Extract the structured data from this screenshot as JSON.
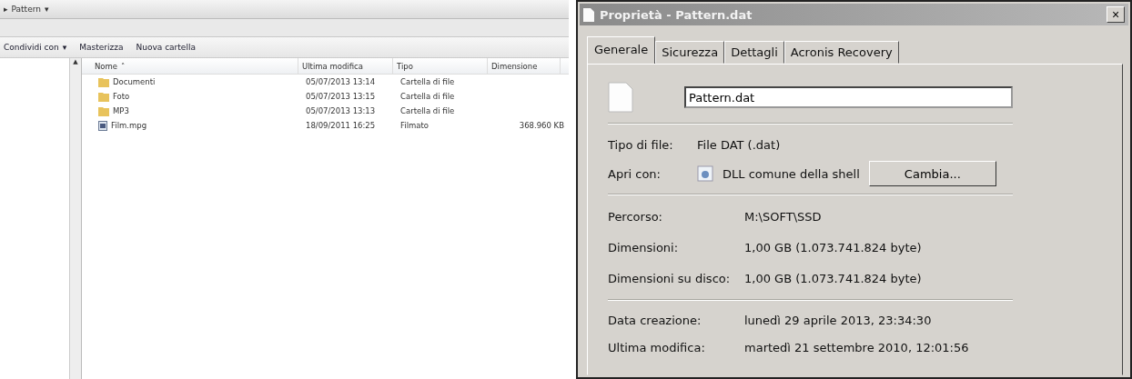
{
  "explorer": {
    "breadcrumb": {
      "arrow": "▸",
      "location": "Pattern",
      "caret": "▾"
    },
    "toolbar": [
      {
        "label": "Condividi con",
        "caret": "▾"
      },
      {
        "label": "Masterizza"
      },
      {
        "label": "Nuova cartella"
      }
    ],
    "nav_scroll_arrow": "▲",
    "columns": [
      "Nome",
      "Ultima modifica",
      "Tipo",
      "Dimensione"
    ],
    "sort_mark": "˄",
    "rows": [
      {
        "kind": "folder",
        "name": "Documenti",
        "modified": "05/07/2013 13:14",
        "type": "Cartella di file",
        "size": ""
      },
      {
        "kind": "folder",
        "name": "Foto",
        "modified": "05/07/2013 13:15",
        "type": "Cartella di file",
        "size": ""
      },
      {
        "kind": "folder",
        "name": "MP3",
        "modified": "05/07/2013 13:13",
        "type": "Cartella di file",
        "size": ""
      },
      {
        "kind": "video",
        "name": "Film.mpg",
        "modified": "18/09/2011 16:25",
        "type": "Filmato",
        "size": "368.960 KB"
      }
    ]
  },
  "dialog": {
    "title": "Proprietà - Pattern.dat",
    "close": "×",
    "tabs": [
      {
        "label": "Generale",
        "selected": true
      },
      {
        "label": "Sicurezza",
        "selected": false
      },
      {
        "label": "Dettagli",
        "selected": false
      },
      {
        "label": "Acronis Recovery",
        "selected": false
      }
    ],
    "file_name": "Pattern.dat",
    "file_type": {
      "label": "Tipo di file:",
      "value": "File DAT (.dat)"
    },
    "open_with": {
      "label": "Apri con:",
      "value": "DLL comune della shell",
      "button": "Cambia..."
    },
    "groups": [
      [
        {
          "label": "Percorso:",
          "value": "M:\\SOFT\\SSD"
        },
        {
          "label": "Dimensioni:",
          "value": "1,00 GB (1.073.741.824 byte)"
        },
        {
          "label": "Dimensioni su disco:",
          "value": "1,00 GB (1.073.741.824 byte)"
        }
      ],
      [
        {
          "label": "Data creazione:",
          "value": "lunedì 29 aprile 2013, 23:34:30"
        },
        {
          "label": "Ultima modifica:",
          "value": "martedì 21 settembre 2010, 12:01:56"
        }
      ]
    ]
  }
}
